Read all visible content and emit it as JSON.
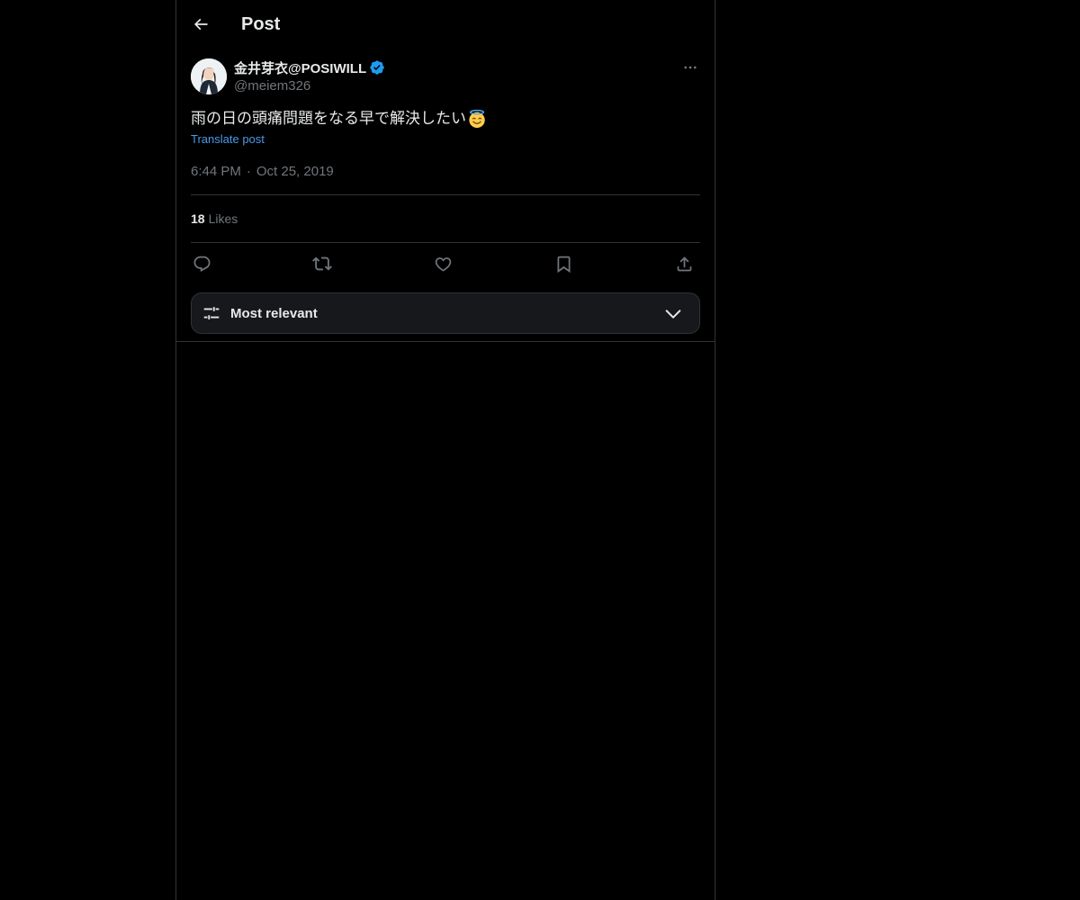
{
  "header": {
    "title": "Post",
    "back_icon": "arrow-left-icon"
  },
  "post": {
    "author": {
      "display_name": "金井芽衣@POSIWILL",
      "handle": "@meiem326",
      "verified": true,
      "verified_color": "#1d9bf0"
    },
    "text": "雨の日の頭痛問題をなる早で解決したい",
    "emoji": "smiling-face-with-halo",
    "translate_label": "Translate post",
    "time": "6:44 PM",
    "separator": "·",
    "date": "Oct 25, 2019",
    "more_icon": "more-horizontal-icon"
  },
  "stats": {
    "likes_count": "18",
    "likes_label": "Likes"
  },
  "actions": [
    {
      "name": "reply",
      "icon": "reply-icon"
    },
    {
      "name": "repost",
      "icon": "repost-icon"
    },
    {
      "name": "like",
      "icon": "heart-icon"
    },
    {
      "name": "bookmark",
      "icon": "bookmark-icon"
    },
    {
      "name": "share",
      "icon": "share-icon"
    }
  ],
  "sort": {
    "label": "Most relevant",
    "icon": "sliders-icon",
    "chevron": "chevron-down-icon"
  },
  "colors": {
    "background": "#000000",
    "text_primary": "#e7e9ea",
    "text_secondary": "#71767b",
    "link": "#4a99e9",
    "border": "#2f3336"
  }
}
